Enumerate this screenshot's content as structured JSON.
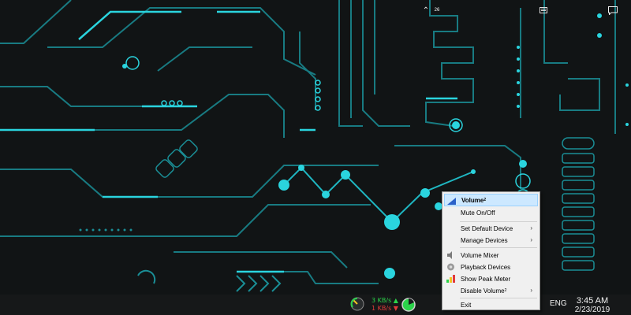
{
  "tray": {
    "upload_speed": "3 KB/s",
    "download_speed": "1 KB/s",
    "volume_level_label": "26",
    "language": "ENG",
    "time": "3:45 AM",
    "date": "2/23/2019",
    "chevron_icon": "chevron-up-icon",
    "notification_icon": "action-center-icon"
  },
  "context_menu": {
    "title_main": "Volume",
    "title_sup": "2",
    "items": {
      "mute": "Mute On/Off",
      "set_default": "Set Default Device",
      "manage": "Manage Devices",
      "mixer": "Volume Mixer",
      "playback": "Playback Devices",
      "peak": "Show Peak Meter",
      "disable_main": "Disable Volume",
      "disable_sup": "2",
      "exit": "Exit"
    }
  },
  "colors": {
    "accent_cyan": "#2ad4de",
    "highlight": "#cce8ff",
    "upload_green": "#2bd24a",
    "download_red": "#e23b3b"
  }
}
